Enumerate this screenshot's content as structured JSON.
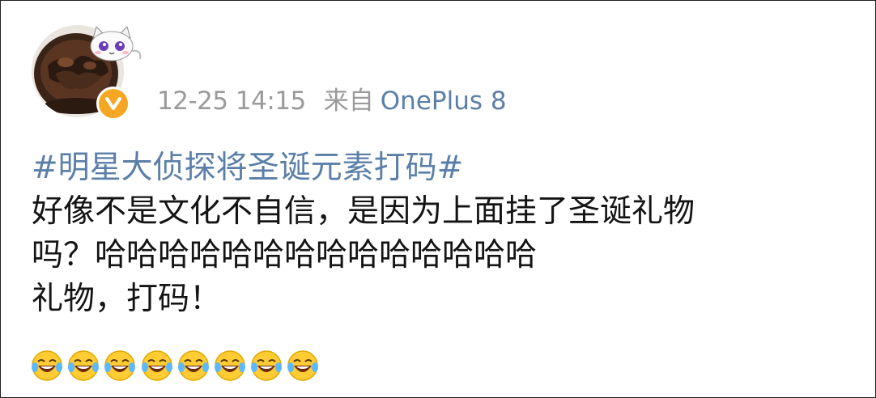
{
  "post": {
    "timestamp": "12-25 14:15",
    "source_prefix": "来自",
    "source_device": "OnePlus 8",
    "hashtag": "#明星大侦探将圣诞元素打码#",
    "body_lines": [
      "好像不是文化不自信，是因为上面挂了圣诞礼物",
      "吗？哈哈哈哈哈哈哈哈哈哈哈哈哈哈",
      "礼物，打码！"
    ],
    "emojis": [
      "laugh-cry-emoji",
      "laugh-cry-emoji",
      "laugh-cry-emoji",
      "laugh-cry-emoji",
      "laugh-cry-emoji",
      "laugh-cry-emoji",
      "laugh-cry-emoji",
      "laugh-cry-emoji"
    ]
  },
  "colors": {
    "link": "#5b7fa8",
    "meta_gray": "#9a9a9a",
    "verified_badge": "#f5a623",
    "text": "#141414"
  }
}
